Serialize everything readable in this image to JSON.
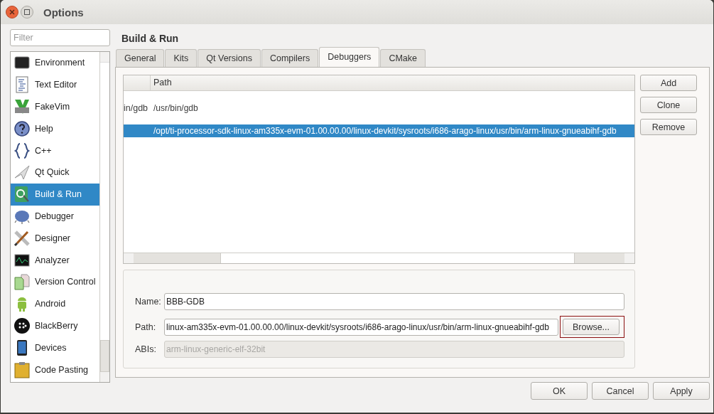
{
  "window": {
    "title": "Options"
  },
  "sidebar": {
    "filter": {
      "placeholder": "Filter"
    },
    "items": [
      {
        "label": "Environment",
        "selected": false
      },
      {
        "label": "Text Editor",
        "selected": false
      },
      {
        "label": "FakeVim",
        "selected": false
      },
      {
        "label": "Help",
        "selected": false
      },
      {
        "label": "C++",
        "selected": false
      },
      {
        "label": "Qt Quick",
        "selected": false
      },
      {
        "label": "Build & Run",
        "selected": true
      },
      {
        "label": "Debugger",
        "selected": false
      },
      {
        "label": "Designer",
        "selected": false
      },
      {
        "label": "Analyzer",
        "selected": false
      },
      {
        "label": "Version Control",
        "selected": false
      },
      {
        "label": "Android",
        "selected": false
      },
      {
        "label": "BlackBerry",
        "selected": false
      },
      {
        "label": "Devices",
        "selected": false
      },
      {
        "label": "Code Pasting",
        "selected": false
      }
    ]
  },
  "page_title": "Build & Run",
  "tabs": [
    {
      "label": "General",
      "selected": false
    },
    {
      "label": "Kits",
      "selected": false
    },
    {
      "label": "Qt Versions",
      "selected": false
    },
    {
      "label": "Compilers",
      "selected": false
    },
    {
      "label": "Debuggers",
      "selected": true
    },
    {
      "label": "CMake",
      "selected": false
    }
  ],
  "table": {
    "columns": [
      "Path"
    ],
    "rows": [
      {
        "column_1": "in/gdb",
        "path": "/usr/bin/gdb",
        "selected": false
      },
      {
        "path": "/opt/ti-processor-sdk-linux-am335x-evm-01.00.00.00/linux-devkit/sysroots/i686-arago-linux/usr/bin/arm-linux-gnueabihf-gdb",
        "selected": true
      }
    ]
  },
  "side_buttons": [
    "Add",
    "Clone",
    "Remove"
  ],
  "details": {
    "name": {
      "label": "Name:",
      "value": "BBB-GDB"
    },
    "path": {
      "label": "Path:",
      "value": "linux-am335x-evm-01.00.00.00/linux-devkit/sysroots/i686-arago-linux/usr/bin/arm-linux-gnueabihf-gdb",
      "button": "Browse...",
      "highlighted": true
    },
    "abis": {
      "label": "ABIs:",
      "value": "arm-linux-generic-elf-32bit",
      "disabled": true
    }
  },
  "buttons": [
    "OK",
    "Cancel",
    "Apply"
  ]
}
